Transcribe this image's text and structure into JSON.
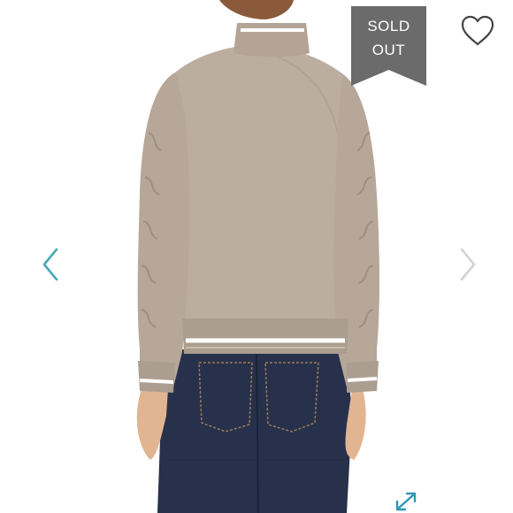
{
  "product_viewer": {
    "badge": {
      "line1": "SOLD",
      "line2": "OUT"
    },
    "icons": {
      "like": "heart-outline-icon",
      "previous": "chevron-left-icon",
      "next": "chevron-right-icon",
      "fullscreen": "expand-arrows-icon"
    },
    "colors": {
      "badge_bg": "#6b6b6b",
      "accent": "#4aa8b8",
      "jacket": "#bdaea3",
      "jeans": "#28324d"
    }
  }
}
